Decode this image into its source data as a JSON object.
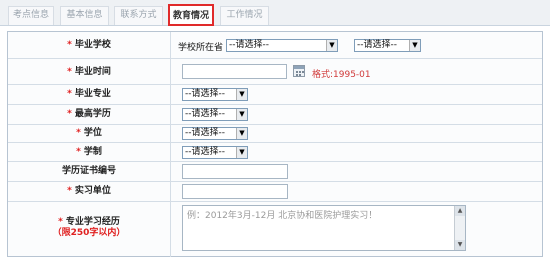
{
  "tabs": [
    {
      "label": "考点信息",
      "active": false
    },
    {
      "label": "基本信息",
      "active": false
    },
    {
      "label": "联系方式",
      "active": false
    },
    {
      "label": "教育情况",
      "active": true
    },
    {
      "label": "工作情况",
      "active": false
    }
  ],
  "colors": {
    "accent": "#e02a2a",
    "required": "#e02020",
    "hint": "#d03a3a"
  },
  "required_mark": "*",
  "form": {
    "graduation_school": {
      "label": "毕业学校",
      "province_prefix": "学校所在省",
      "province_value": "--请选择--",
      "school_value": "--请选择--"
    },
    "graduation_time": {
      "label": "毕业时间",
      "value": "",
      "format_hint": "格式:1995-01",
      "icon": "calendar-icon"
    },
    "graduation_major": {
      "label": "毕业专业",
      "value": "--请选择--"
    },
    "highest_education": {
      "label": "最高学历",
      "value": "--请选择--"
    },
    "degree": {
      "label": "学位",
      "value": "--请选择--"
    },
    "school_system": {
      "label": "学制",
      "value": "--请选择--"
    },
    "certificate_number": {
      "label": "学历证书编号",
      "value": ""
    },
    "internship_unit": {
      "label": "实习单位",
      "value": ""
    },
    "study_experience": {
      "label": "专业学习经历",
      "note": "（限250字以内）",
      "placeholder": "例：2012年3月-12月 北京协和医院护理实习！"
    }
  }
}
